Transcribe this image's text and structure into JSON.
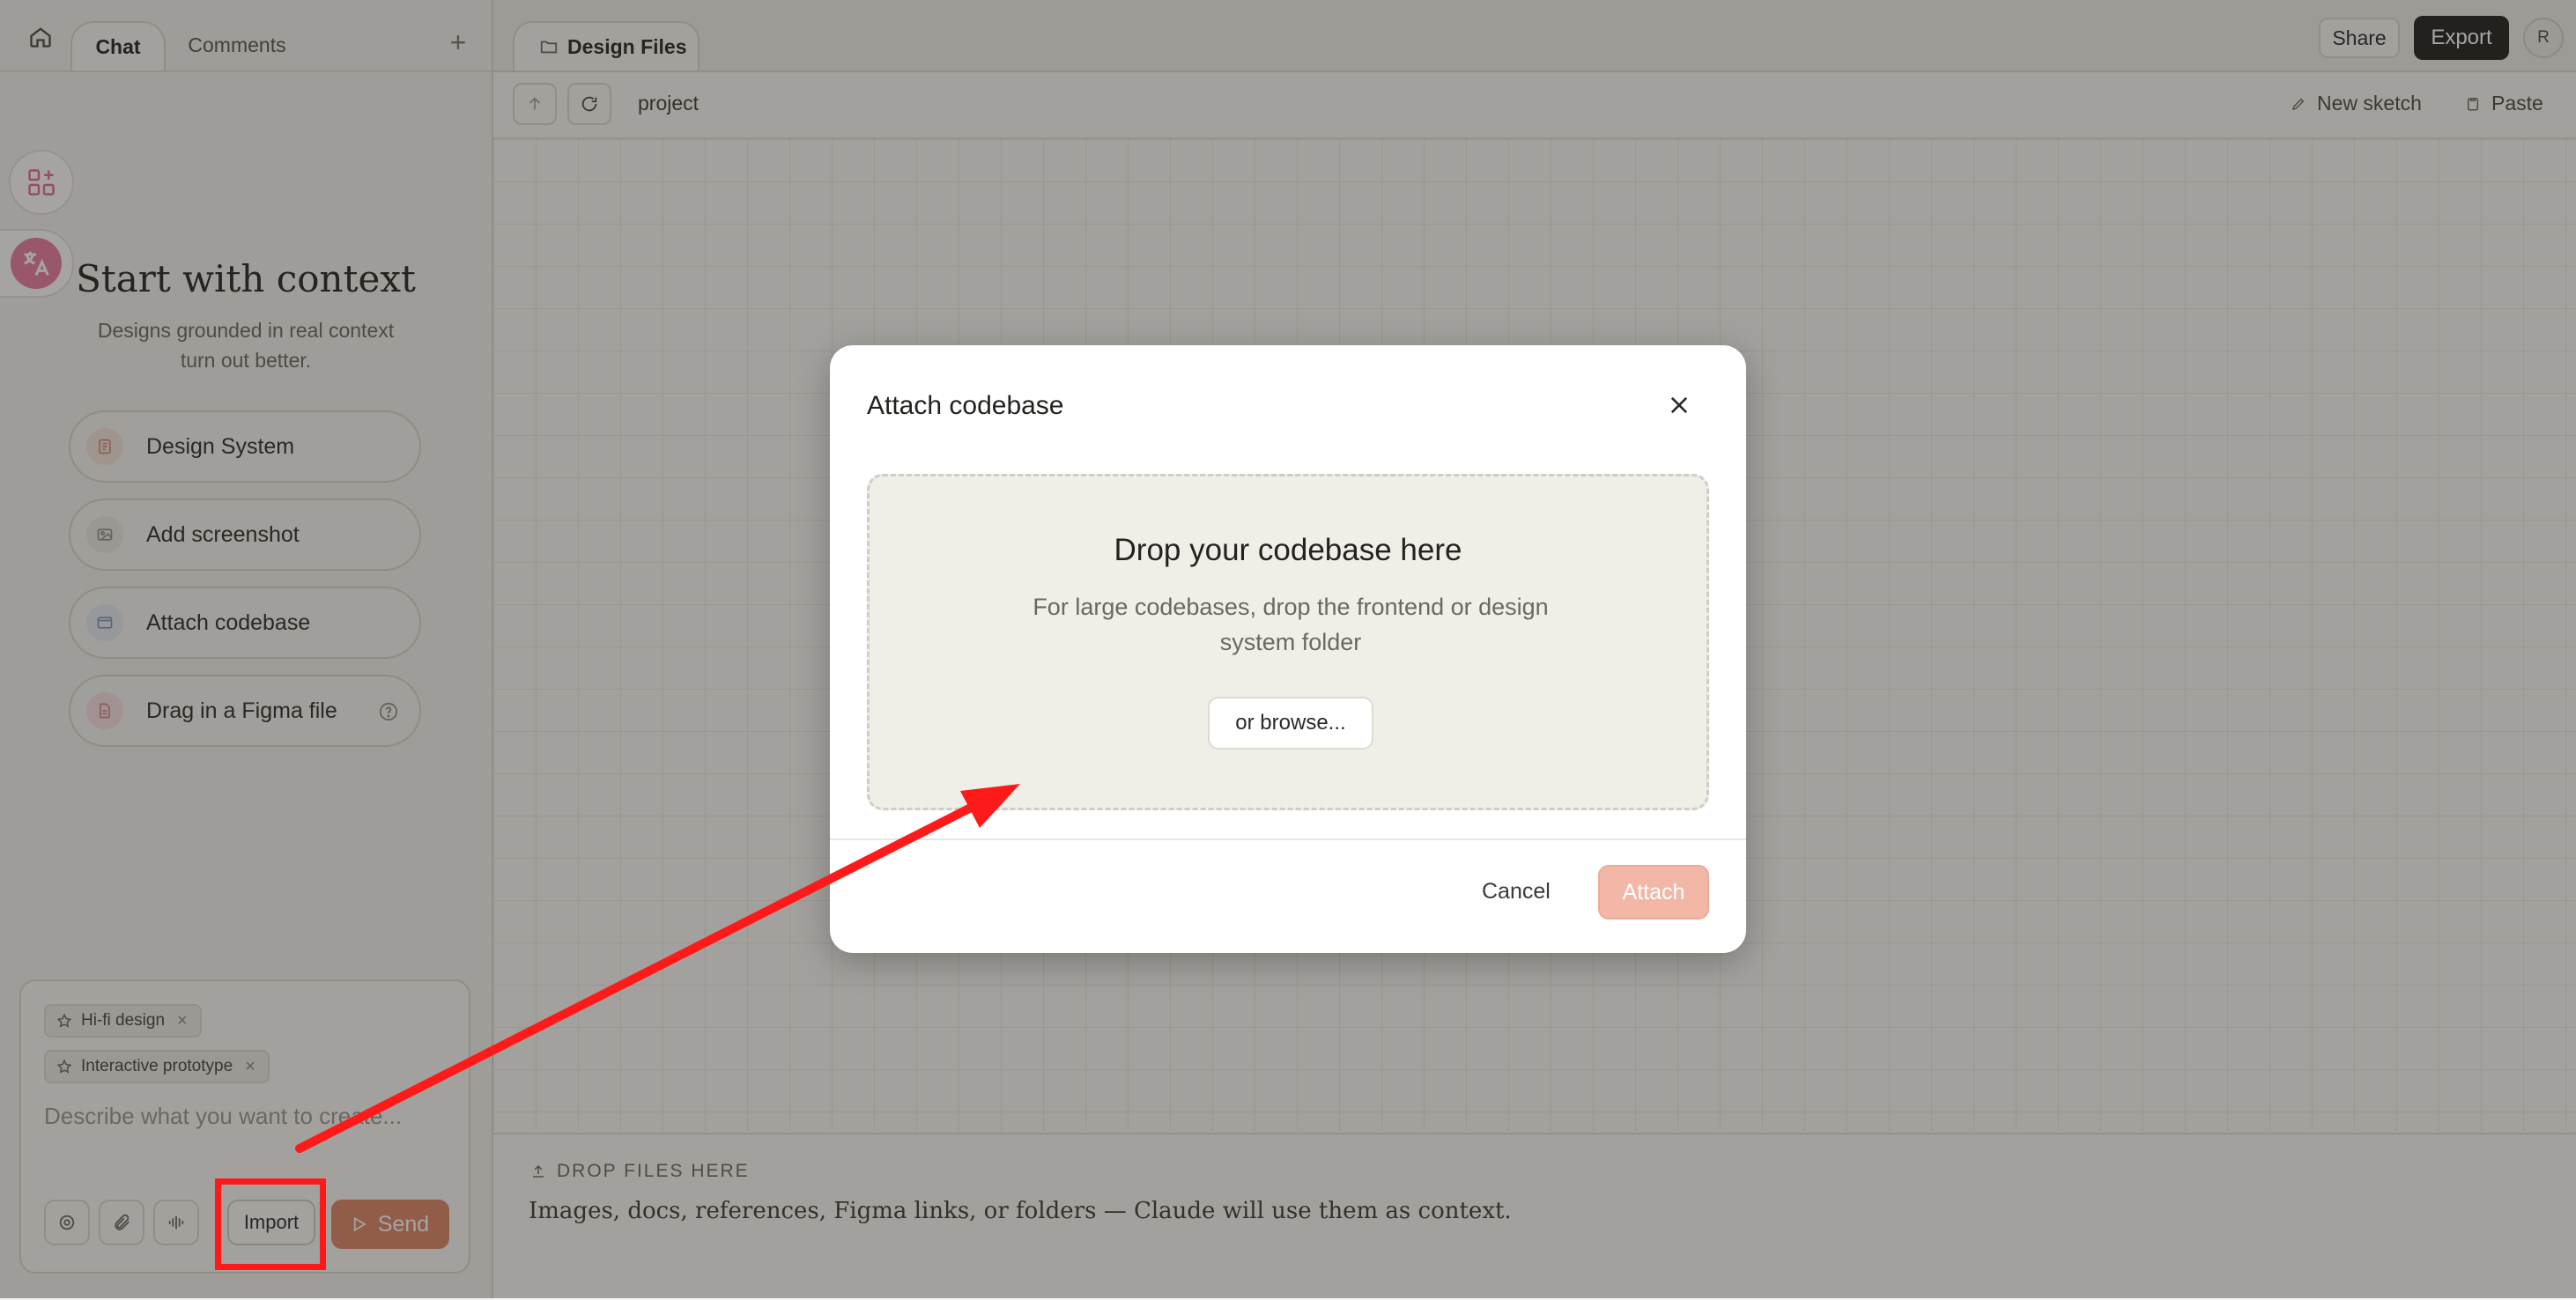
{
  "sidebar": {
    "tabs": [
      {
        "label": "Chat",
        "active": true
      },
      {
        "label": "Comments",
        "active": false
      }
    ],
    "context": {
      "title": "Start with context",
      "subtitle": "Designs grounded in real context turn out better.",
      "options": [
        {
          "label": "Design System",
          "icon": "document-icon",
          "color": "#e9b8a8"
        },
        {
          "label": "Add screenshot",
          "icon": "image-icon",
          "color": "#c9c8bf"
        },
        {
          "label": "Attach codebase",
          "icon": "code-folder-icon",
          "color": "#b9c8dc"
        },
        {
          "label": "Drag in a Figma file",
          "icon": "figma-file-icon",
          "color": "#ebb2b8"
        }
      ]
    },
    "composer": {
      "chips": [
        "Hi-fi design",
        "Interactive prototype"
      ],
      "placeholder": "Describe what you want to create...",
      "import_label": "Import",
      "send_label": "Send"
    }
  },
  "main": {
    "file_tab": "Design Files",
    "share_label": "Share",
    "export_label": "Export",
    "avatar_initial": "R",
    "breadcrumb": "project",
    "new_sketch_label": "New sketch",
    "paste_label": "Paste",
    "drop_heading": "DROP FILES HERE",
    "drop_description": "Images, docs, references, Figma links, or folders — Claude will use them as context."
  },
  "modal": {
    "title": "Attach codebase",
    "drop_title": "Drop your codebase here",
    "drop_description": "For large codebases, drop the frontend or design system folder",
    "browse_label": "or browse...",
    "cancel_label": "Cancel",
    "attach_label": "Attach"
  },
  "colors": {
    "accent": "#dd8566",
    "attach_disabled": "#f2b7a6",
    "annotation": "#ff1a1a"
  }
}
